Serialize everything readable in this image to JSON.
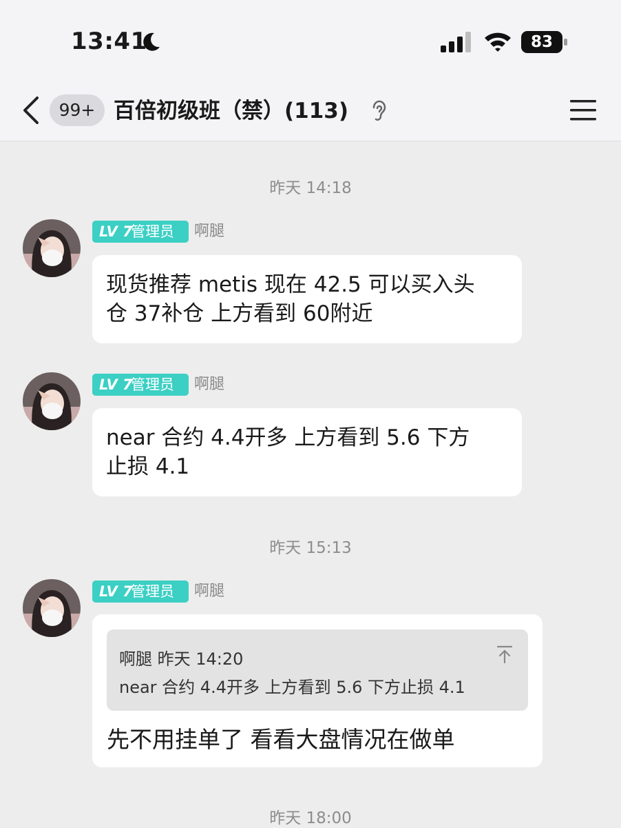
{
  "status_bar": {
    "time": "13:41",
    "battery": "83",
    "icons": [
      "moon-icon",
      "signal-icon",
      "wifi-icon",
      "battery-icon"
    ]
  },
  "nav": {
    "unread_badge": "99+",
    "title": "百倍初级班（禁）(113)",
    "icons": [
      "back-icon",
      "ear-icon",
      "menu-icon"
    ]
  },
  "colors": {
    "level_badge": "#3ccfc4",
    "bubble": "#ffffff",
    "background": "#ededed"
  },
  "timestamps": [
    "昨天 14:18",
    "昨天 15:13",
    "昨天 18:00"
  ],
  "messages": [
    {
      "level": "LV 7",
      "role": "管理员",
      "sender": "啊腿",
      "lines": [
        "现货推荐 metis 现在 42.5 可以买入头",
        "仓 37补仓 上方看到 60附近"
      ]
    },
    {
      "level": "LV 7",
      "role": "管理员",
      "sender": "啊腿",
      "lines": [
        "near 合约 4.4开多 上方看到 5.6 下方",
        "止损 4.1"
      ]
    },
    {
      "level": "LV 7",
      "role": "管理员",
      "sender": "啊腿",
      "quote": {
        "header": "啊腿 昨天 14:20",
        "text": "near 合约 4.4开多 上方看到 5.6 下方止损 4.1"
      },
      "text": "先不用挂单了  看看大盘情况在做单"
    }
  ]
}
